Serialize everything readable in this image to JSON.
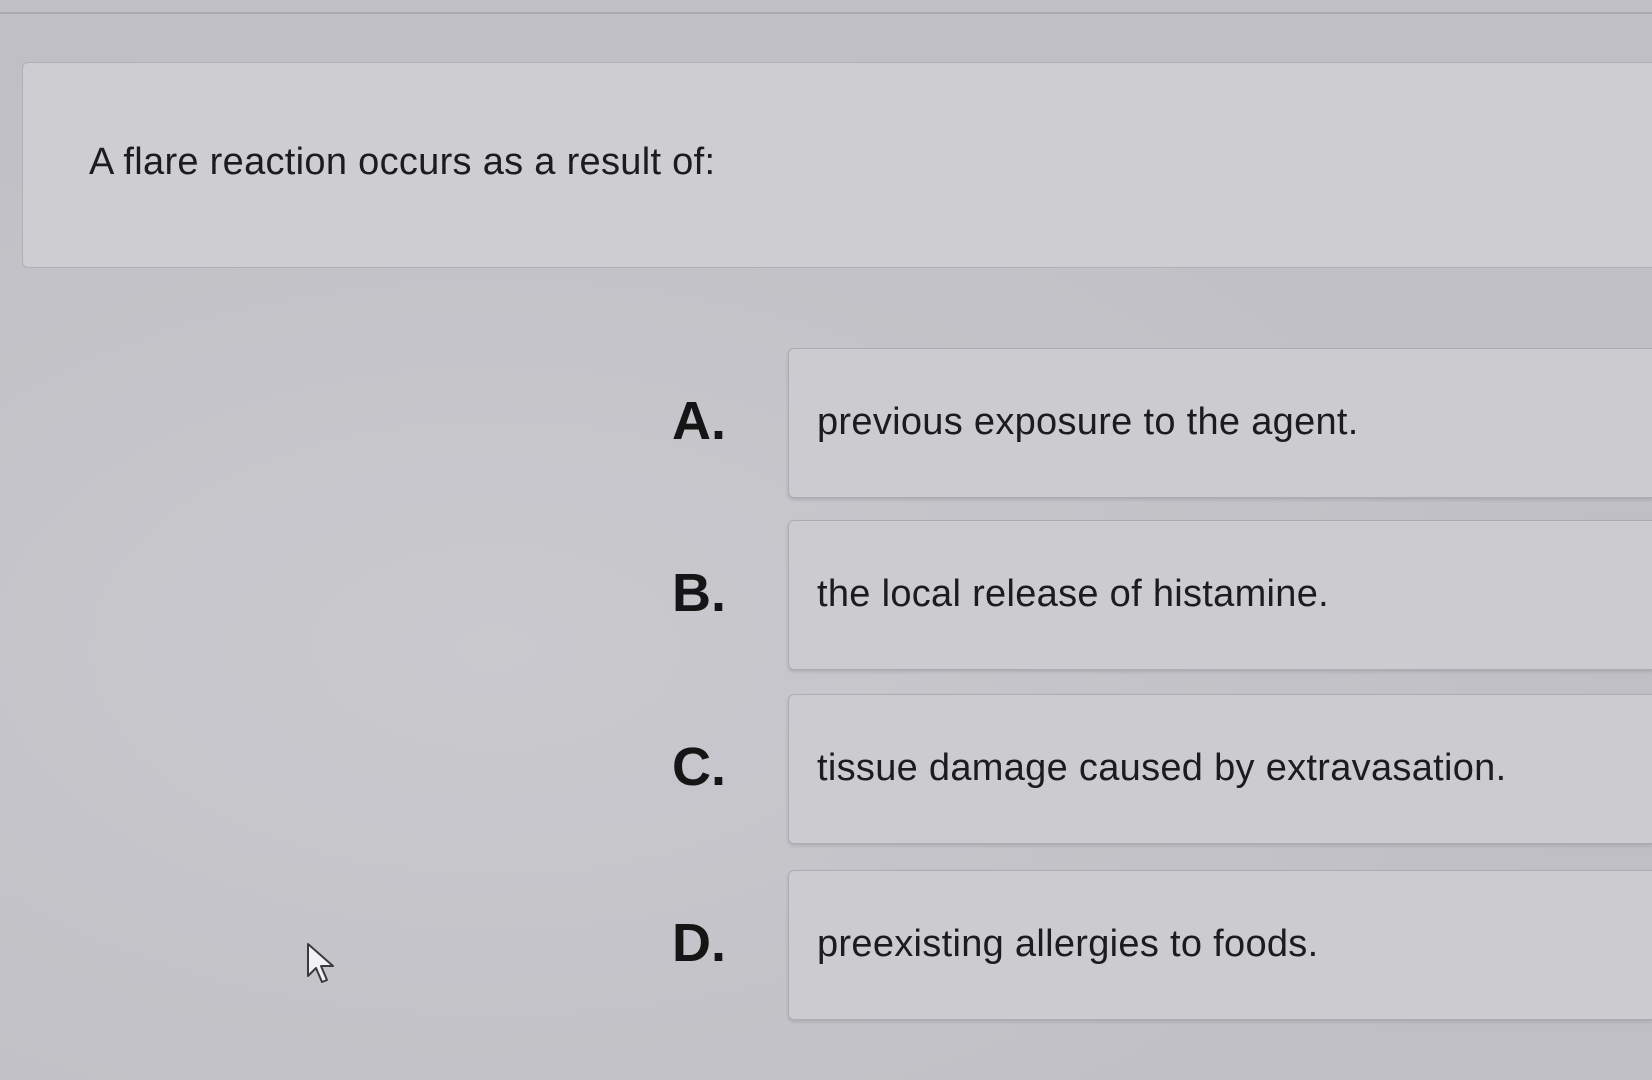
{
  "question": {
    "text": "A flare reaction occurs as a result of:"
  },
  "answers": [
    {
      "letter": "A.",
      "text": "previous exposure to the agent."
    },
    {
      "letter": "B.",
      "text": "the local release of histamine."
    },
    {
      "letter": "C.",
      "text": "tissue damage caused by extravasation."
    },
    {
      "letter": "D.",
      "text": "preexisting allergies to foods."
    }
  ],
  "cursor": {
    "icon": "arrow-pointer-icon"
  }
}
